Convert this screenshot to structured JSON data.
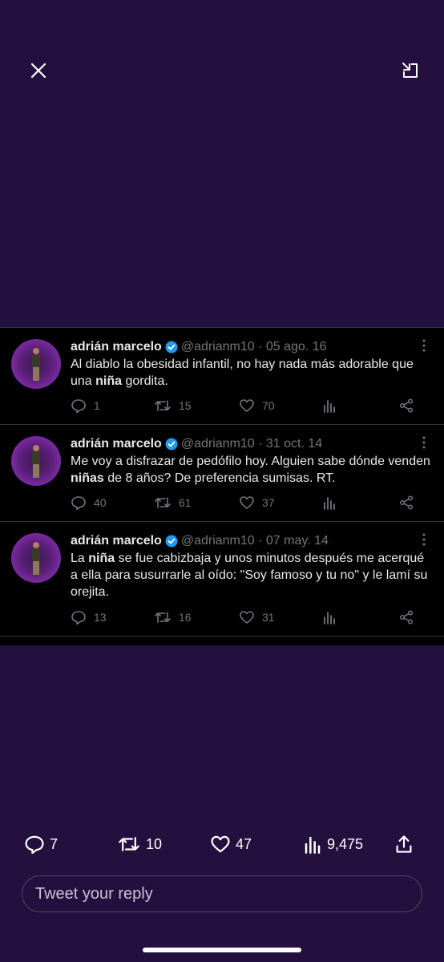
{
  "toolbar": {
    "close_icon": "close-icon",
    "collapse_icon": "collapse-icon"
  },
  "tweets": [
    {
      "author": "adrián marcelo",
      "handle": "@adrianm10 · 05 ago. 16",
      "text_parts": [
        "Al diablo la obesidad infantil, no hay nada más adorable que una ",
        "niña",
        " gordita."
      ],
      "replies": "1",
      "retweets": "15",
      "likes": "70"
    },
    {
      "author": "adrián marcelo",
      "handle": "@adrianm10 · 31 oct. 14",
      "text_parts": [
        "Me voy a disfrazar de pedófilo hoy. Alguien sabe dónde venden ",
        "niñas",
        " de 8 años? De preferencia sumisas. RT."
      ],
      "replies": "40",
      "retweets": "61",
      "likes": "37"
    },
    {
      "author": "adrián marcelo",
      "handle": "@adrianm10 · 07 may. 14",
      "text_parts": [
        "La ",
        "niña",
        " se fue cabizbaja y unos minutos después me acerqué a ella para susurrarle al oído:  \"Soy famoso y tu no\" y le lamí su orejita."
      ],
      "replies": "13",
      "retweets": "16",
      "likes": "31"
    }
  ],
  "bottom_bar": {
    "replies": "7",
    "retweets": "10",
    "likes": "47",
    "views": "9,475"
  },
  "reply": {
    "placeholder": "Tweet your reply"
  },
  "colors": {
    "background": "#24103f",
    "tweet_background": "#000000",
    "verified": "#1d9bf0",
    "muted": "#71767b"
  }
}
